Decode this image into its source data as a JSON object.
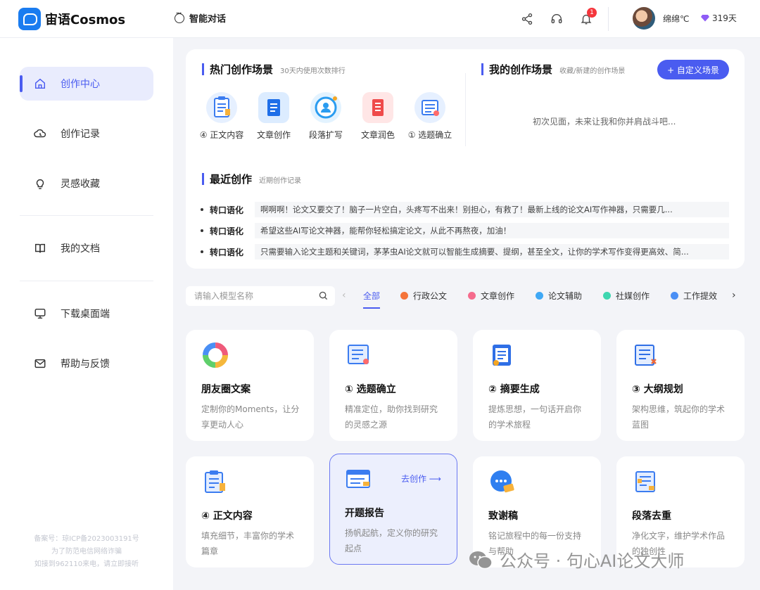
{
  "header": {
    "app_name": "宙语Cosmos",
    "chat_label": "智能对话",
    "notification_count": "1",
    "username": "绵绵℃",
    "days": "319天"
  },
  "sidebar": {
    "items": [
      {
        "label": "创作中心",
        "icon": "home-icon"
      },
      {
        "label": "创作记录",
        "icon": "cloud-icon"
      },
      {
        "label": "灵感收藏",
        "icon": "bulb-icon"
      },
      {
        "label": "我的文档",
        "icon": "book-icon"
      },
      {
        "label": "下载桌面端",
        "icon": "monitor-icon"
      },
      {
        "label": "帮助与反馈",
        "icon": "mail-icon"
      }
    ],
    "icp_lines": [
      "备案号：琼ICP备2023003191号",
      "为了防范电信网络诈骗",
      "如接到962110来电，请立即接听"
    ]
  },
  "hot": {
    "title": "热门创作场景",
    "subtitle": "30天内使用次数排行",
    "items": [
      "④ 正文内容",
      "文章创作",
      "段落扩写",
      "文章润色",
      "① 选题确立"
    ]
  },
  "mine": {
    "title": "我的创作场景",
    "subtitle": "收藏/新建的创作场景",
    "button": "+ 自定义场景",
    "empty": "初次见面，未来让我和你并肩战斗吧..."
  },
  "recent": {
    "title": "最近创作",
    "subtitle": "近期创作记录",
    "rows": [
      {
        "tag": "转口语化",
        "text": "啊啊啊！论文又要交了！脑子一片空白，头疼写不出来！别担心，有救了！最新上线的论文AI写作神器，只需要几..."
      },
      {
        "tag": "转口语化",
        "text": "希望这些AI写论文神器，能帮你轻松搞定论文，从此不再熬夜，加油！"
      },
      {
        "tag": "转口语化",
        "text": "只需要输入论文主题和关键词，茅茅虫AI论文就可以智能生成摘要、提纲，甚至全文，让你的学术写作变得更高效、简..."
      }
    ]
  },
  "search": {
    "placeholder": "请输入模型名称"
  },
  "tabs": [
    {
      "label": "全部",
      "color": ""
    },
    {
      "label": "行政公文",
      "color": "#f5743a"
    },
    {
      "label": "文章创作",
      "color": "#f56b8d"
    },
    {
      "label": "论文辅助",
      "color": "#3fa8f5"
    },
    {
      "label": "社媒创作",
      "color": "#3ed6b0"
    },
    {
      "label": "工作提效",
      "color": "#4a8ff5"
    }
  ],
  "cards": [
    {
      "title": "朋友圈文案",
      "desc": "定制你的Moments，让分享更动人心",
      "icon": "rainbow-ring-icon"
    },
    {
      "title": "① 选题确立",
      "desc": "精准定位，助你找到研究的灵感之源",
      "icon": "document-list-icon"
    },
    {
      "title": "② 摘要生成",
      "desc": "提炼思想，一句话开启你的学术旅程",
      "icon": "summary-icon"
    },
    {
      "title": "③ 大纲规划",
      "desc": "架构思维，筑起你的学术蓝图",
      "icon": "outline-icon"
    },
    {
      "title": "④ 正文内容",
      "desc": "填充细节，丰富你的学术篇章",
      "icon": "clipboard-icon"
    },
    {
      "title": "开题报告",
      "desc": "扬帆起航，定义你的研究起点",
      "icon": "report-icon",
      "action": "去创作 ⟶"
    },
    {
      "title": "致谢稿",
      "desc": "铭记旅程中的每一份支持与帮助",
      "icon": "thanks-icon"
    },
    {
      "title": "段落去重",
      "desc": "净化文字，维护学术作品的独创性",
      "icon": "dedupe-icon"
    }
  ],
  "watermark": "公众号 · 句心AI论文大师"
}
